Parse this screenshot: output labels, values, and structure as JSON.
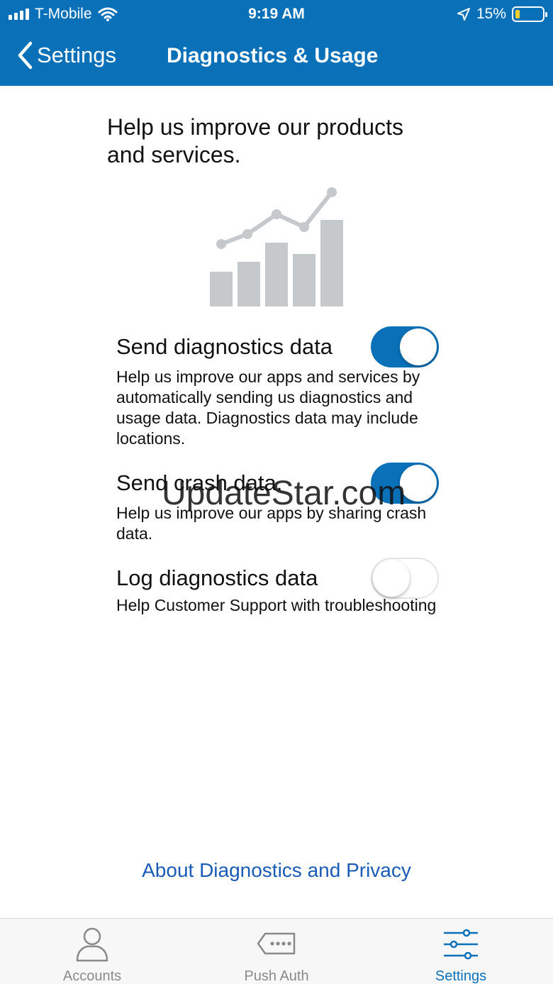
{
  "status_bar": {
    "carrier": "T-Mobile",
    "time": "9:19 AM",
    "battery_percent": "15%",
    "battery_level": 0.15,
    "icons": [
      "signal-icon",
      "wifi-icon",
      "location-arrow-icon",
      "battery-icon"
    ]
  },
  "nav": {
    "back_label": "Settings",
    "title": "Diagnostics & Usage"
  },
  "intro_text": "Help us improve our products and services.",
  "settings": [
    {
      "title": "Send diagnostics data",
      "description": "Help us improve our apps and services by automatically sending us diagnostics and usage data. Diagnostics data may include locations.",
      "enabled": true
    },
    {
      "title": "Send crash data.",
      "description": "Help us improve our apps by sharing crash data.",
      "enabled": true
    },
    {
      "title": "Log diagnostics data",
      "description": "Help Customer Support with troubleshooting",
      "enabled": false
    }
  ],
  "watermark": "UpdateStar.com",
  "about_link": "About Diagnostics and Privacy",
  "tabs": [
    {
      "label": "Accounts",
      "icon": "person-icon",
      "active": false
    },
    {
      "label": "Push Auth",
      "icon": "password-tag-icon",
      "active": false
    },
    {
      "label": "Settings",
      "icon": "sliders-icon",
      "active": true
    }
  ],
  "colors": {
    "brand_blue": "#0a70b8",
    "link_blue": "#1a5bb5",
    "illustration_gray": "#c5c9cc",
    "battery_low": "#f4d02c"
  }
}
